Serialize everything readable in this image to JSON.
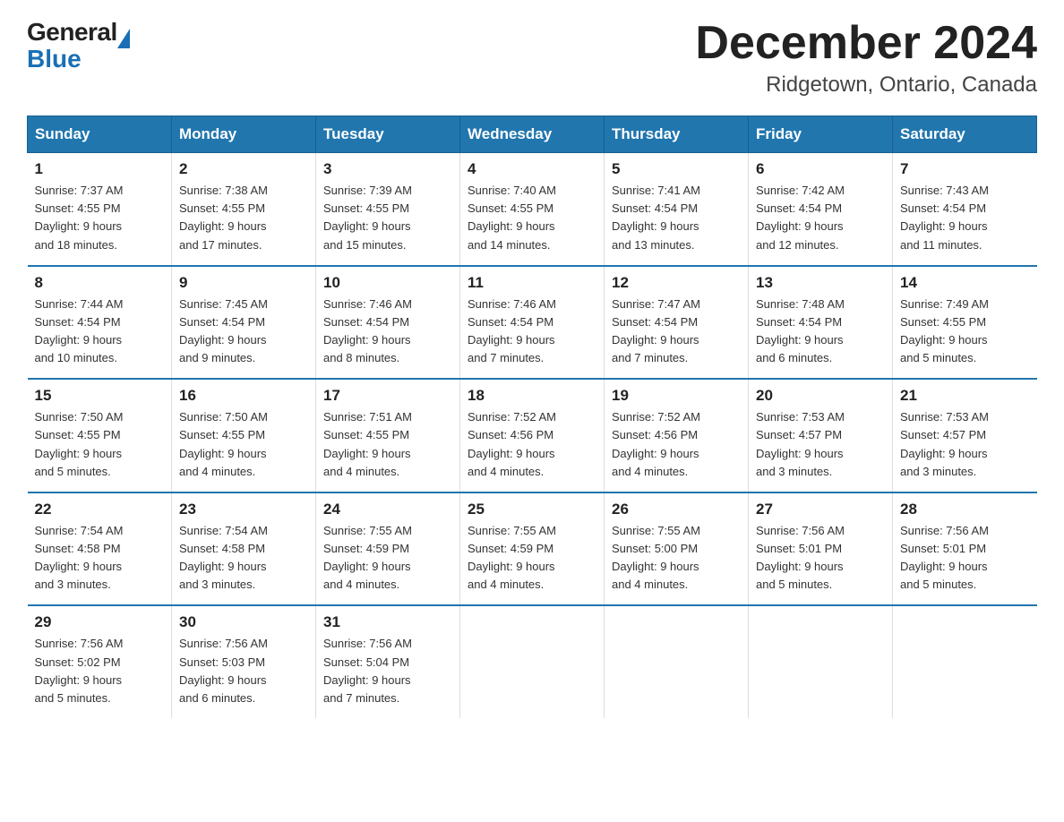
{
  "header": {
    "logo_text_general": "General",
    "logo_text_blue": "Blue",
    "title": "December 2024",
    "subtitle": "Ridgetown, Ontario, Canada"
  },
  "weekdays": [
    "Sunday",
    "Monday",
    "Tuesday",
    "Wednesday",
    "Thursday",
    "Friday",
    "Saturday"
  ],
  "weeks": [
    [
      {
        "day": "1",
        "sunrise": "7:37 AM",
        "sunset": "4:55 PM",
        "daylight": "9 hours and 18 minutes."
      },
      {
        "day": "2",
        "sunrise": "7:38 AM",
        "sunset": "4:55 PM",
        "daylight": "9 hours and 17 minutes."
      },
      {
        "day": "3",
        "sunrise": "7:39 AM",
        "sunset": "4:55 PM",
        "daylight": "9 hours and 15 minutes."
      },
      {
        "day": "4",
        "sunrise": "7:40 AM",
        "sunset": "4:55 PM",
        "daylight": "9 hours and 14 minutes."
      },
      {
        "day": "5",
        "sunrise": "7:41 AM",
        "sunset": "4:54 PM",
        "daylight": "9 hours and 13 minutes."
      },
      {
        "day": "6",
        "sunrise": "7:42 AM",
        "sunset": "4:54 PM",
        "daylight": "9 hours and 12 minutes."
      },
      {
        "day": "7",
        "sunrise": "7:43 AM",
        "sunset": "4:54 PM",
        "daylight": "9 hours and 11 minutes."
      }
    ],
    [
      {
        "day": "8",
        "sunrise": "7:44 AM",
        "sunset": "4:54 PM",
        "daylight": "9 hours and 10 minutes."
      },
      {
        "day": "9",
        "sunrise": "7:45 AM",
        "sunset": "4:54 PM",
        "daylight": "9 hours and 9 minutes."
      },
      {
        "day": "10",
        "sunrise": "7:46 AM",
        "sunset": "4:54 PM",
        "daylight": "9 hours and 8 minutes."
      },
      {
        "day": "11",
        "sunrise": "7:46 AM",
        "sunset": "4:54 PM",
        "daylight": "9 hours and 7 minutes."
      },
      {
        "day": "12",
        "sunrise": "7:47 AM",
        "sunset": "4:54 PM",
        "daylight": "9 hours and 7 minutes."
      },
      {
        "day": "13",
        "sunrise": "7:48 AM",
        "sunset": "4:54 PM",
        "daylight": "9 hours and 6 minutes."
      },
      {
        "day": "14",
        "sunrise": "7:49 AM",
        "sunset": "4:55 PM",
        "daylight": "9 hours and 5 minutes."
      }
    ],
    [
      {
        "day": "15",
        "sunrise": "7:50 AM",
        "sunset": "4:55 PM",
        "daylight": "9 hours and 5 minutes."
      },
      {
        "day": "16",
        "sunrise": "7:50 AM",
        "sunset": "4:55 PM",
        "daylight": "9 hours and 4 minutes."
      },
      {
        "day": "17",
        "sunrise": "7:51 AM",
        "sunset": "4:55 PM",
        "daylight": "9 hours and 4 minutes."
      },
      {
        "day": "18",
        "sunrise": "7:52 AM",
        "sunset": "4:56 PM",
        "daylight": "9 hours and 4 minutes."
      },
      {
        "day": "19",
        "sunrise": "7:52 AM",
        "sunset": "4:56 PM",
        "daylight": "9 hours and 4 minutes."
      },
      {
        "day": "20",
        "sunrise": "7:53 AM",
        "sunset": "4:57 PM",
        "daylight": "9 hours and 3 minutes."
      },
      {
        "day": "21",
        "sunrise": "7:53 AM",
        "sunset": "4:57 PM",
        "daylight": "9 hours and 3 minutes."
      }
    ],
    [
      {
        "day": "22",
        "sunrise": "7:54 AM",
        "sunset": "4:58 PM",
        "daylight": "9 hours and 3 minutes."
      },
      {
        "day": "23",
        "sunrise": "7:54 AM",
        "sunset": "4:58 PM",
        "daylight": "9 hours and 3 minutes."
      },
      {
        "day": "24",
        "sunrise": "7:55 AM",
        "sunset": "4:59 PM",
        "daylight": "9 hours and 4 minutes."
      },
      {
        "day": "25",
        "sunrise": "7:55 AM",
        "sunset": "4:59 PM",
        "daylight": "9 hours and 4 minutes."
      },
      {
        "day": "26",
        "sunrise": "7:55 AM",
        "sunset": "5:00 PM",
        "daylight": "9 hours and 4 minutes."
      },
      {
        "day": "27",
        "sunrise": "7:56 AM",
        "sunset": "5:01 PM",
        "daylight": "9 hours and 5 minutes."
      },
      {
        "day": "28",
        "sunrise": "7:56 AM",
        "sunset": "5:01 PM",
        "daylight": "9 hours and 5 minutes."
      }
    ],
    [
      {
        "day": "29",
        "sunrise": "7:56 AM",
        "sunset": "5:02 PM",
        "daylight": "9 hours and 5 minutes."
      },
      {
        "day": "30",
        "sunrise": "7:56 AM",
        "sunset": "5:03 PM",
        "daylight": "9 hours and 6 minutes."
      },
      {
        "day": "31",
        "sunrise": "7:56 AM",
        "sunset": "5:04 PM",
        "daylight": "9 hours and 7 minutes."
      },
      null,
      null,
      null,
      null
    ]
  ],
  "labels": {
    "sunrise": "Sunrise:",
    "sunset": "Sunset:",
    "daylight": "Daylight:"
  }
}
